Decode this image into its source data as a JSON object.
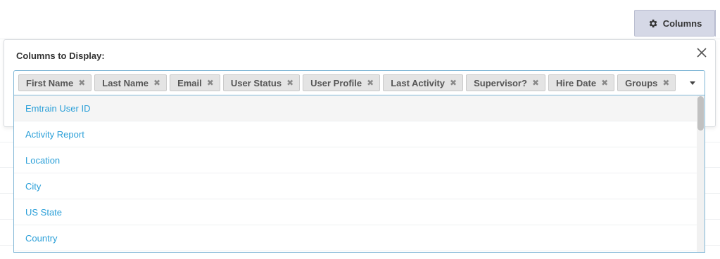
{
  "toolbar": {
    "columns_label": "Columns",
    "columns_icon": "gear-icon"
  },
  "panel": {
    "title": "Columns to Display:",
    "close_icon": "close-icon"
  },
  "selected_columns": [
    {
      "label": "First Name"
    },
    {
      "label": "Last Name"
    },
    {
      "label": "Email"
    },
    {
      "label": "User Status"
    },
    {
      "label": "User Profile"
    },
    {
      "label": "Last Activity"
    },
    {
      "label": "Supervisor?"
    },
    {
      "label": "Hire Date"
    },
    {
      "label": "Groups"
    }
  ],
  "remove_glyph": "✖",
  "options": [
    {
      "label": "Emtrain User ID",
      "highlighted": true
    },
    {
      "label": "Activity Report"
    },
    {
      "label": "Location"
    },
    {
      "label": "City"
    },
    {
      "label": "US State"
    },
    {
      "label": "Country"
    }
  ],
  "colors": {
    "accent": "#2a9fd8",
    "button_bg": "#d5d8e6",
    "tag_bg": "#e4e4e4",
    "focus_border": "#7fb6d6"
  }
}
